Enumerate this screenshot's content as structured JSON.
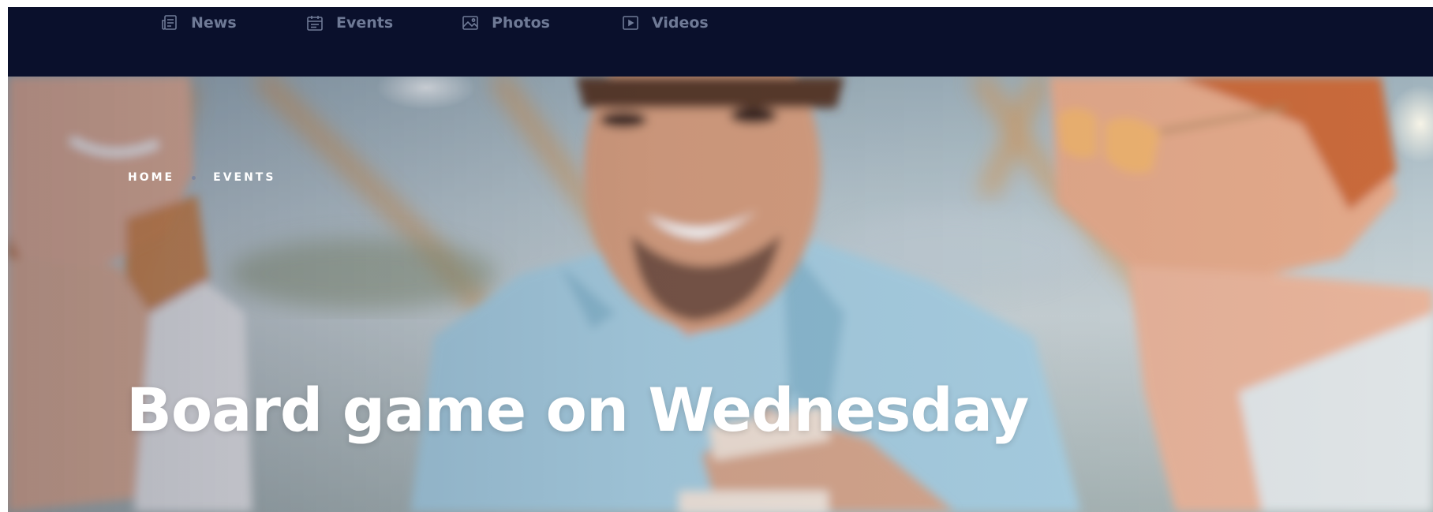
{
  "nav": {
    "items": [
      {
        "label": "News",
        "icon": "news-icon"
      },
      {
        "label": "Events",
        "icon": "calendar-icon"
      },
      {
        "label": "Photos",
        "icon": "image-icon"
      },
      {
        "label": "Videos",
        "icon": "video-play-icon"
      }
    ]
  },
  "breadcrumb": {
    "home": "HOME",
    "current": "EVENTS"
  },
  "hero": {
    "title": "Board game on Wednesday",
    "image": "hero-photo-friends-playing-board-game"
  },
  "colors": {
    "nav_bg": "#0a102c",
    "nav_text": "#6f7a96",
    "title_text": "#ffffff",
    "breadcrumb_sep": "#7d869f"
  }
}
